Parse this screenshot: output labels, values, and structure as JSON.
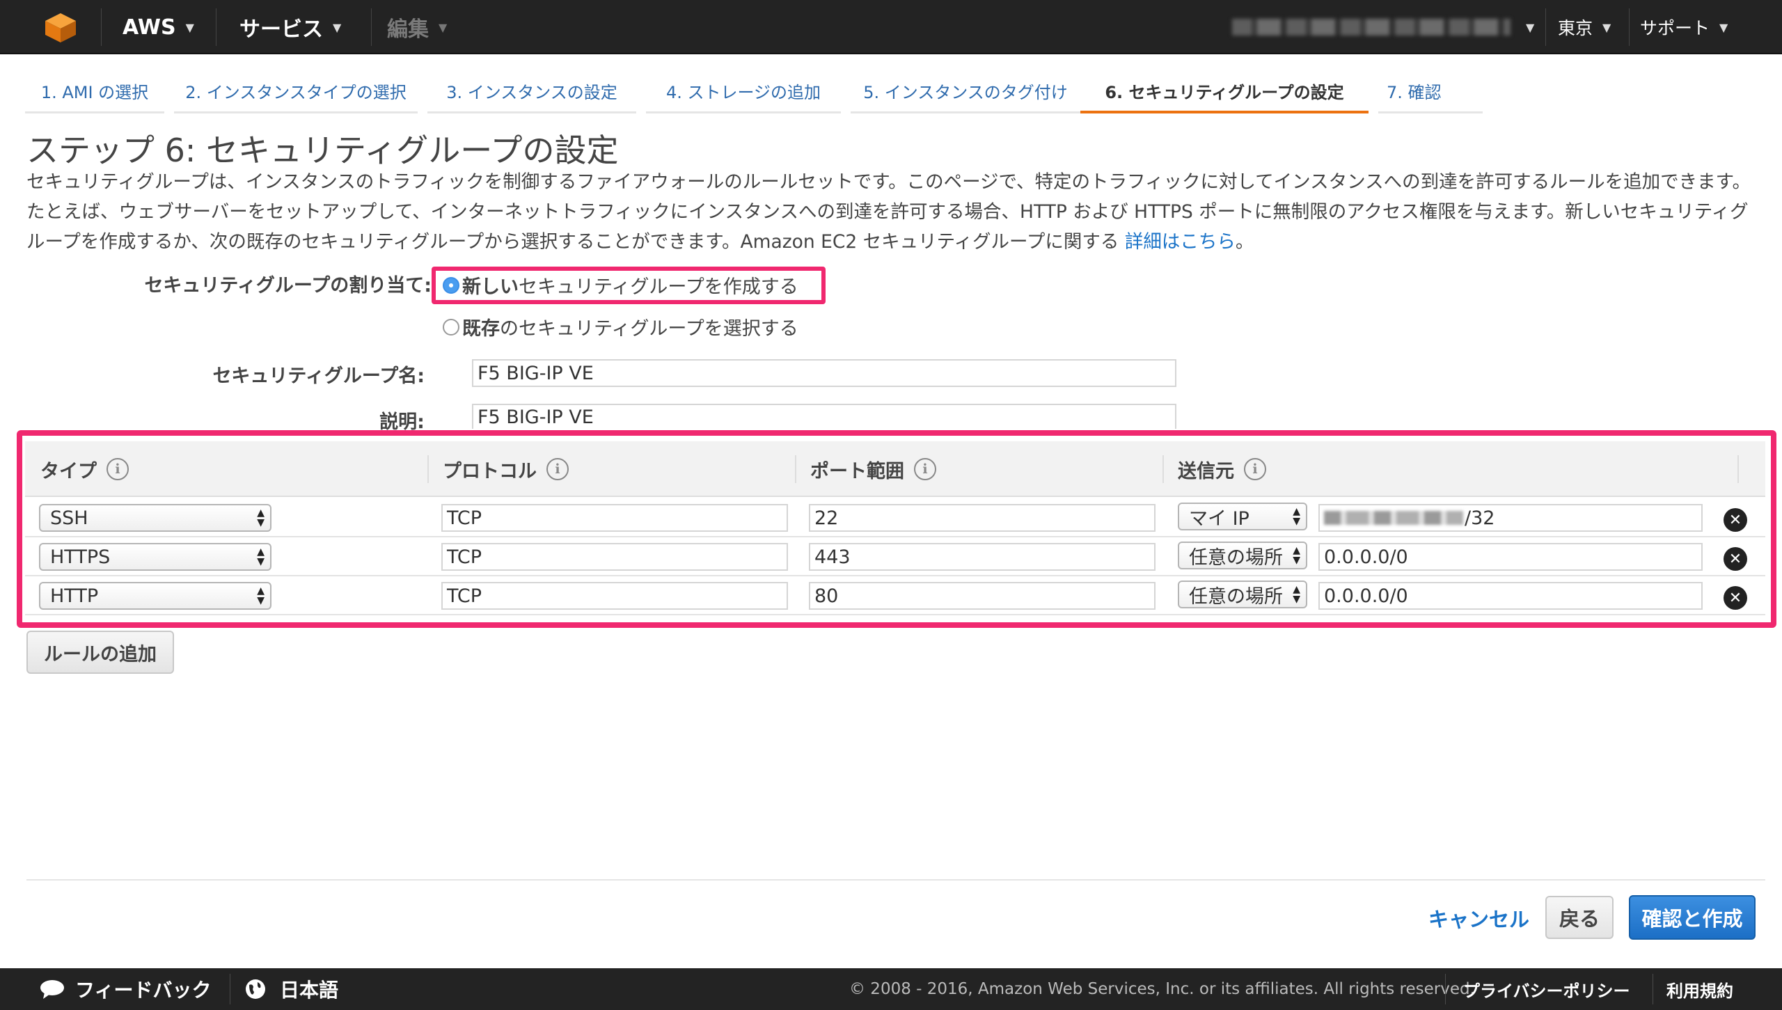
{
  "nav": {
    "brand": "AWS",
    "services": "サービス",
    "edit": "編集",
    "region": "東京",
    "support": "サポート"
  },
  "tabs": [
    {
      "label": "1. AMI の選択"
    },
    {
      "label": "2. インスタンスタイプの選択"
    },
    {
      "label": "3. インスタンスの設定"
    },
    {
      "label": "4. ストレージの追加"
    },
    {
      "label": "5. インスタンスのタグ付け"
    },
    {
      "label": "6. セキュリティグループの設定"
    },
    {
      "label": "7. 確認"
    }
  ],
  "page": {
    "title": "ステップ 6: セキュリティグループの設定",
    "description": "セキュリティグループは、インスタンスのトラフィックを制御するファイアウォールのルールセットです。このページで、特定のトラフィックに対してインスタンスへの到達を許可するルールを追加できます。たとえば、ウェブサーバーをセットアップして、インターネットトラフィックにインスタンスへの到達を許可する場合、HTTP および HTTPS ポートに無制限のアクセス権限を与えます。新しいセキュリティグループを作成するか、次の既存のセキュリティグループから選択することができます。Amazon EC2 セキュリティグループに関する ",
    "learn_more": "詳細はこちら",
    "desc_end": "。"
  },
  "assign": {
    "label": "セキュリティグループの割り当て:",
    "option_new_bold": "新しい",
    "option_new_rest": "セキュリティグループを作成する",
    "option_existing_bold": "既存",
    "option_existing_rest": "のセキュリティグループを選択する",
    "selected": "new"
  },
  "form": {
    "name_label": "セキュリティグループ名:",
    "name_value": "F5 BIG-IP VE",
    "desc_label": "説明:",
    "desc_value": "F5 BIG-IP VE"
  },
  "table": {
    "headers": {
      "type": "タイプ",
      "protocol": "プロトコル",
      "port_range": "ポート範囲",
      "source": "送信元"
    },
    "info_glyph": "i",
    "rows": [
      {
        "type": "SSH",
        "protocol": "TCP",
        "port": "22",
        "source_type": "マイ IP",
        "source_value": "/32"
      },
      {
        "type": "HTTPS",
        "protocol": "TCP",
        "port": "443",
        "source_type": "任意の場所",
        "source_value": "0.0.0.0/0"
      },
      {
        "type": "HTTP",
        "protocol": "TCP",
        "port": "80",
        "source_type": "任意の場所",
        "source_value": "0.0.0.0/0"
      }
    ],
    "add_rule": "ルールの追加"
  },
  "actions": {
    "cancel": "キャンセル",
    "back": "戻る",
    "review_launch": "確認と作成"
  },
  "footer": {
    "feedback": "フィードバック",
    "language": "日本語",
    "copyright": "© 2008 - 2016, Amazon Web Services, Inc. or its affiliates. All rights reserved.",
    "privacy": "プライバシーポリシー",
    "terms": "利用規約"
  },
  "colors": {
    "accent_orange": "#ec7211",
    "highlight_pink": "#f0286f",
    "link_blue": "#1a73c8",
    "primary_blue": "#1c6fc6"
  },
  "icons": {
    "logo": "aws-cube-icon",
    "caret": "chevron-down-icon",
    "info": "info-icon",
    "remove": "remove-circle-icon",
    "feedback": "chat-bubble-icon",
    "language": "globe-icon"
  }
}
